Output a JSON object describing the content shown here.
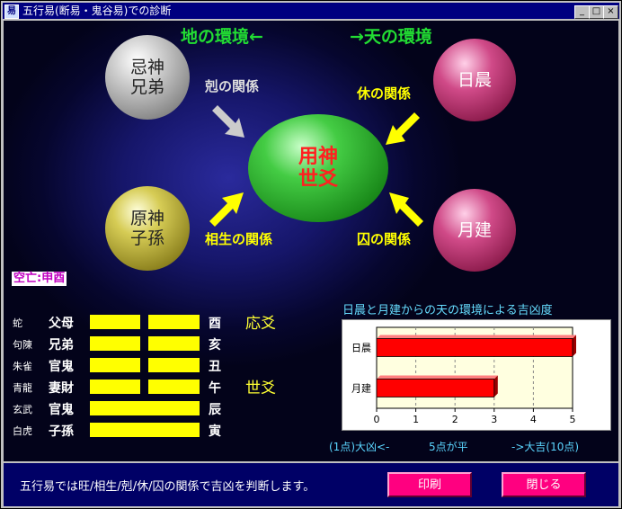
{
  "window": {
    "title": "五行易(断易・鬼谷易)での診断",
    "icon_label": "易",
    "controls": {
      "minimize": "_",
      "maximize": "□",
      "close": "×"
    }
  },
  "headers": {
    "earth": "地の環境←",
    "heaven": "→天の環境"
  },
  "spheres": {
    "center": {
      "line1": "用神",
      "line2": "世爻",
      "color": "#22aa22"
    },
    "top_left": {
      "line1": "忌神",
      "line2": "兄弟"
    },
    "bottom_left": {
      "line1": "原神",
      "line2": "子孫"
    },
    "top_right": {
      "label": "日晨"
    },
    "bottom_right": {
      "label": "月建"
    }
  },
  "relations": {
    "top_left": "剋の関係",
    "top_right": "休の関係",
    "bottom_left": "相生の関係",
    "bottom_right": "囚の関係"
  },
  "kongwang": "空亡:申酉",
  "hexagram": [
    {
      "god": "蛇",
      "relation": "父母",
      "branch": "酉",
      "mark": "応爻",
      "yang": false
    },
    {
      "god": "句陳",
      "relation": "兄弟",
      "branch": "亥",
      "mark": "",
      "yang": false
    },
    {
      "god": "朱雀",
      "relation": "官鬼",
      "branch": "丑",
      "mark": "",
      "yang": false
    },
    {
      "god": "青龍",
      "relation": "妻財",
      "branch": "午",
      "mark": "世爻",
      "yang": false
    },
    {
      "god": "玄武",
      "relation": "官鬼",
      "branch": "辰",
      "mark": "",
      "yang": true
    },
    {
      "god": "白虎",
      "relation": "子孫",
      "branch": "寅",
      "mark": "",
      "yang": true
    }
  ],
  "chart_title": "日晨と月建からの天の環境による吉凶度",
  "chart_data": {
    "type": "bar",
    "orientation": "horizontal",
    "categories": [
      "日晨",
      "月建"
    ],
    "values": [
      5,
      3
    ],
    "xlim": [
      0,
      5
    ],
    "xticks": [
      "0",
      "1",
      "2",
      "3",
      "4",
      "5"
    ],
    "grid": true,
    "bar_color": "#ff0000"
  },
  "scale_labels": {
    "left": "(1点)大凶<-",
    "mid": "5点が平",
    "right": "->大吉(10点)"
  },
  "status_text": "五行易では旺/相生/剋/休/囚の関係で吉凶を判断します。",
  "buttons": {
    "print": "印刷",
    "close": "閉じる"
  }
}
